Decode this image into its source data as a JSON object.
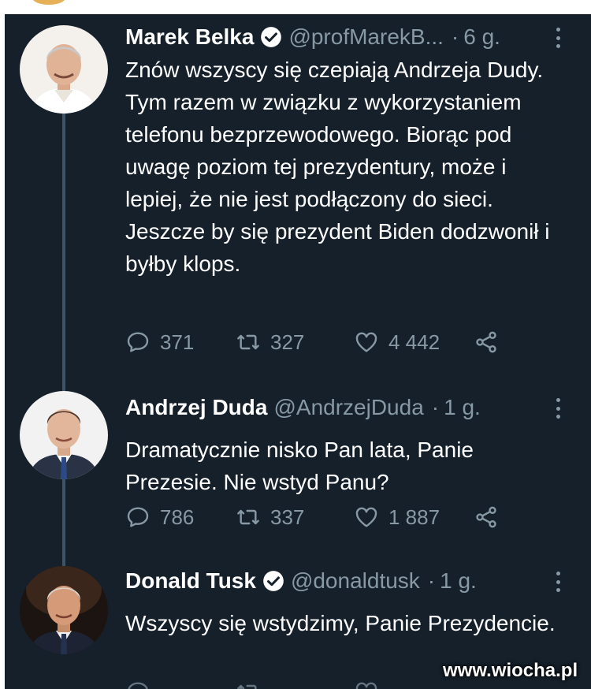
{
  "tweets": [
    {
      "name": "Marek Belka",
      "verified": true,
      "handle": "@profMarekB...",
      "time": "6 g.",
      "text": "Znów wszyscy się czepiają Andrzeja Dudy. Tym razem w związku z wykorzystaniem telefonu bezprzewodowego. Biorąc pod uwagę poziom tej prezydentury, może i lepiej, że nie jest podłączony do sieci. Jeszcze by się prezydent Biden dodzwonił i byłby klops.",
      "replies": "371",
      "retweets": "327",
      "likes": "4 442"
    },
    {
      "name": "Andrzej Duda",
      "verified": false,
      "handle": "@AndrzejDuda",
      "time": "1 g.",
      "text": "Dramatycznie nisko Pan lata, Panie Prezesie. Nie wstyd Panu?",
      "replies": "786",
      "retweets": "337",
      "likes": "1 887"
    },
    {
      "name": "Donald Tusk",
      "verified": true,
      "handle": "@donaldtusk",
      "time": "1 g.",
      "text": "Wszyscy się wstydzimy, Panie Prezydencie."
    }
  ],
  "icons": {
    "reply": "reply-icon",
    "retweet": "retweet-icon",
    "like": "like-icon",
    "share": "share-icon",
    "more": "more-icon",
    "verified": "verified-badge-icon"
  },
  "colors": {
    "background": "#15202b",
    "text": "#ffffff",
    "secondary": "#8899a6",
    "thread_line": "#3d5466"
  },
  "watermark": "www.wiocha.pl"
}
